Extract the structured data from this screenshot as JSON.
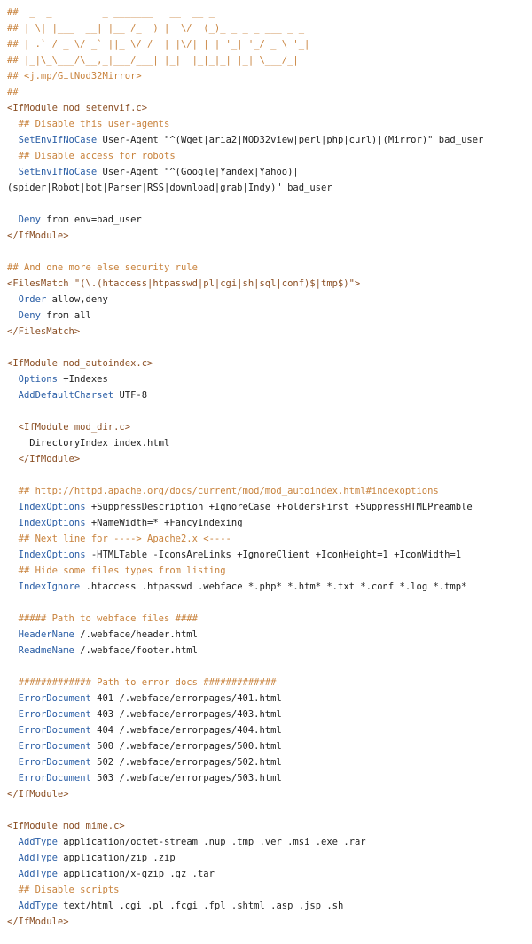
{
  "lines": [
    [
      "##  _  _         _ _______   __  __ _ "
    ],
    [
      "## | \\| |___  __| |__ /_  ) |  \\/  (_)_ _ _ _ ___ _ _ "
    ],
    [
      "## | .` / _ \\/ _` ||_ \\/ /  | |\\/| | | '_| '_/ _ \\ '_|"
    ],
    [
      "## |_|\\_\\___/\\__,_|___/___| |_|  |_|_|_| |_| \\___/_|  "
    ],
    [
      "## <j.mp/GitNod32Mirror>"
    ],
    [
      "##"
    ],
    [
      "<IfModule mod_setenvif.c>"
    ],
    [
      "  ## Disable this user-agents"
    ],
    [
      "  SetEnvIfNoCase User-Agent \"^(Wget|aria2|NOD32view|perl|php|curl)|(Mirror)\" bad_user"
    ],
    [
      "  ## Disable access for robots"
    ],
    [
      "  SetEnvIfNoCase User-Agent \"^(Google|Yandex|Yahoo)|"
    ],
    [
      "(spider|Robot|bot|Parser|RSS|download|grab|Indy)\" bad_user"
    ],
    [
      ""
    ],
    [
      "  Deny from env=bad_user"
    ],
    [
      "</IfModule>"
    ],
    [
      ""
    ],
    [
      "## And one more else security rule"
    ],
    [
      "<FilesMatch \"(\\.(htaccess|htpasswd|pl|cgi|sh|sql|conf)$|tmp$)\">"
    ],
    [
      "  Order allow,deny"
    ],
    [
      "  Deny from all"
    ],
    [
      "</FilesMatch>"
    ],
    [
      ""
    ],
    [
      "<IfModule mod_autoindex.c>"
    ],
    [
      "  Options +Indexes"
    ],
    [
      "  AddDefaultCharset UTF-8"
    ],
    [
      ""
    ],
    [
      "  <IfModule mod_dir.c>"
    ],
    [
      "    DirectoryIndex index.html"
    ],
    [
      "  </IfModule>"
    ],
    [
      ""
    ],
    [
      "  ## http://httpd.apache.org/docs/current/mod/mod_autoindex.html#indexoptions"
    ],
    [
      "  IndexOptions +SuppressDescription +IgnoreCase +FoldersFirst +SuppressHTMLPreamble"
    ],
    [
      "  IndexOptions +NameWidth=* +FancyIndexing"
    ],
    [
      "  ## Next line for ----> Apache2.x <----"
    ],
    [
      "  IndexOptions -HTMLTable -IconsAreLinks +IgnoreClient +IconHeight=1 +IconWidth=1"
    ],
    [
      "  ## Hide some files types from listing"
    ],
    [
      "  IndexIgnore .htaccess .htpasswd .webface *.php* *.htm* *.txt *.conf *.log *.tmp*"
    ],
    [
      ""
    ],
    [
      "  ##### Path to webface files ####"
    ],
    [
      "  HeaderName /.webface/header.html"
    ],
    [
      "  ReadmeName /.webface/footer.html"
    ],
    [
      ""
    ],
    [
      "  ############# Path to error docs #############"
    ],
    [
      "  ErrorDocument 401 /.webface/errorpages/401.html"
    ],
    [
      "  ErrorDocument 403 /.webface/errorpages/403.html"
    ],
    [
      "  ErrorDocument 404 /.webface/errorpages/404.html"
    ],
    [
      "  ErrorDocument 500 /.webface/errorpages/500.html"
    ],
    [
      "  ErrorDocument 502 /.webface/errorpages/502.html"
    ],
    [
      "  ErrorDocument 503 /.webface/errorpages/503.html"
    ],
    [
      "</IfModule>"
    ],
    [
      ""
    ],
    [
      "<IfModule mod_mime.c>"
    ],
    [
      "  AddType application/octet-stream .nup .tmp .ver .msi .exe .rar"
    ],
    [
      "  AddType application/zip .zip"
    ],
    [
      "  AddType application/x-gzip .gz .tar"
    ],
    [
      "  ## Disable scripts"
    ],
    [
      "  AddType text/html .cgi .pl .fcgi .fpl .shtml .asp .jsp .sh"
    ],
    [
      "</IfModule>"
    ]
  ]
}
